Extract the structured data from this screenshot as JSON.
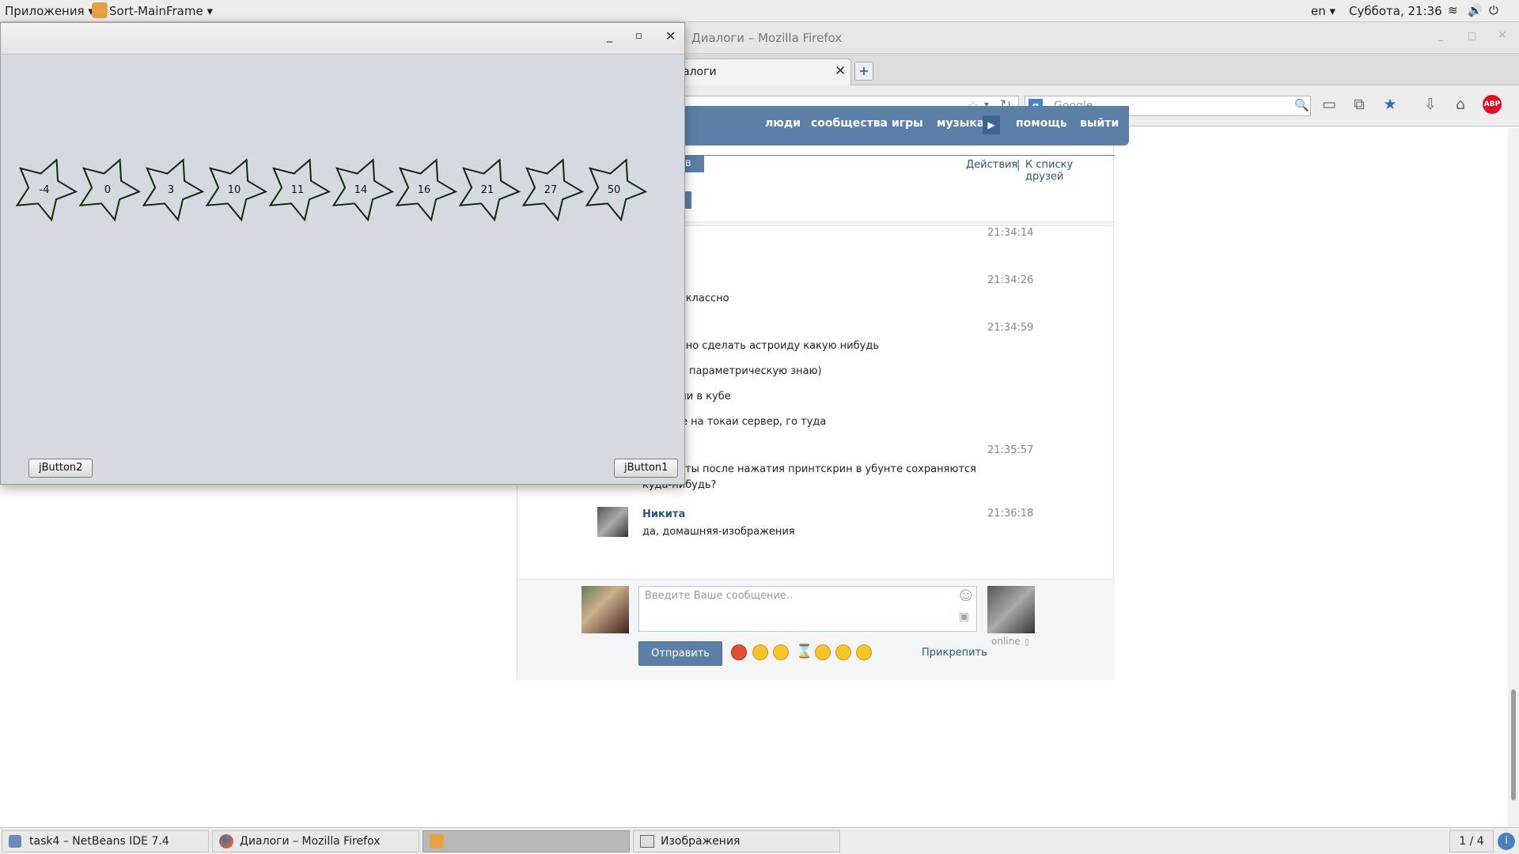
{
  "topbar": {
    "apps_menu": "Приложения",
    "active_app": "Sort-MainFrame",
    "language": "en",
    "clock": "Суббота, 21:36"
  },
  "firefox": {
    "window_title": "Диалоги – Mozilla Firefox",
    "tab_title": "алоги",
    "search_placeholder": "Google"
  },
  "vk": {
    "nav": [
      "люди",
      "сообщества",
      "игры",
      "музыка",
      "помощь",
      "выйти"
    ],
    "tab_fragment": "ов",
    "actions_link": "Действия",
    "separator": "|",
    "friends_link": "К списку друзей",
    "messages": [
      {
        "time": "21:34:14",
        "lines": []
      },
      {
        "time": "21:34:26",
        "lines": [
          "т классно"
        ]
      },
      {
        "time": "21:34:59",
        "lines": [
          "жно сделать астроиду какую нибудь",
          "параметрическую знаю)",
          "ми в кубе",
          "е на токаи сервер, го туда"
        ]
      },
      {
        "time": "21:35:57",
        "lines": [
          "ты после нажатия принтскрин в убунте сохраняются",
          "куда-нибудь?"
        ]
      },
      {
        "time": "21:36:18",
        "author": "Никита",
        "lines": [
          "да, домашняя-изображения"
        ]
      }
    ],
    "composer": {
      "placeholder": "Введите Ваше сообщение..",
      "send_label": "Отправить",
      "attach_label": "Прикрепить",
      "status": "online"
    }
  },
  "java_window": {
    "stars": [
      "-4",
      "0",
      "3",
      "10",
      "11",
      "14",
      "16",
      "21",
      "27",
      "50"
    ],
    "button_left": "jButton2",
    "button_right": "jButton1"
  },
  "taskbar": {
    "items": [
      "task4 – NetBeans IDE 7.4",
      "Диалоги – Mozilla Firefox",
      "",
      "Изображения"
    ],
    "workspace": "1 / 4"
  },
  "colors": {
    "vk_blue": "#5b7fa6",
    "vk_link": "#2b587a",
    "star_stroke": "#0c2a0c"
  }
}
